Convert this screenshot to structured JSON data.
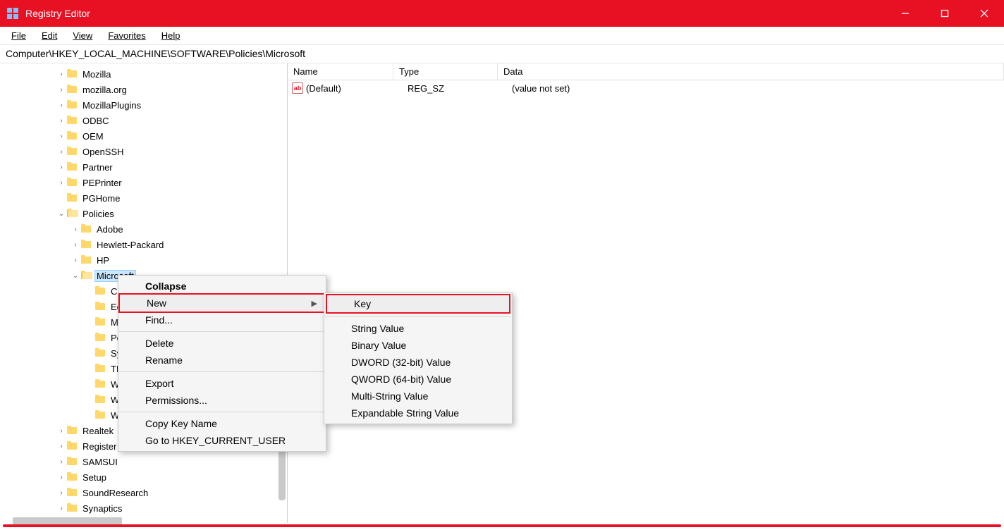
{
  "window": {
    "title": "Registry Editor"
  },
  "menu": {
    "file": "File",
    "edit": "Edit",
    "view": "View",
    "favorites": "Favorites",
    "help": "Help"
  },
  "address": "Computer\\HKEY_LOCAL_MACHINE\\SOFTWARE\\Policies\\Microsoft",
  "tree": {
    "items": [
      {
        "indent": 4,
        "label": "Mozilla"
      },
      {
        "indent": 4,
        "label": "mozilla.org"
      },
      {
        "indent": 4,
        "label": "MozillaPlugins"
      },
      {
        "indent": 4,
        "label": "ODBC"
      },
      {
        "indent": 4,
        "label": "OEM"
      },
      {
        "indent": 4,
        "label": "OpenSSH"
      },
      {
        "indent": 4,
        "label": "Partner"
      },
      {
        "indent": 4,
        "label": "PEPrinter"
      },
      {
        "indent": 4,
        "label": "PGHome",
        "notwisty": true
      },
      {
        "indent": 4,
        "label": "Policies",
        "expanded": true
      },
      {
        "indent": 5,
        "label": "Adobe"
      },
      {
        "indent": 5,
        "label": "Hewlett-Packard"
      },
      {
        "indent": 5,
        "label": "HP"
      },
      {
        "indent": 5,
        "label": "Microsoft",
        "expanded": true,
        "selected": true
      },
      {
        "indent": 6,
        "label": "Cr",
        "notwisty": true
      },
      {
        "indent": 6,
        "label": "Ed",
        "notwisty": true
      },
      {
        "indent": 6,
        "label": "M",
        "notwisty": true
      },
      {
        "indent": 6,
        "label": "Pe",
        "notwisty": true
      },
      {
        "indent": 6,
        "label": "Sy",
        "notwisty": true
      },
      {
        "indent": 6,
        "label": "TP",
        "notwisty": true
      },
      {
        "indent": 6,
        "label": "W",
        "notwisty": true
      },
      {
        "indent": 6,
        "label": "W",
        "notwisty": true
      },
      {
        "indent": 6,
        "label": "W",
        "notwisty": true
      },
      {
        "indent": 4,
        "label": "Realtek"
      },
      {
        "indent": 4,
        "label": "Register"
      },
      {
        "indent": 4,
        "label": "SAMSUI"
      },
      {
        "indent": 4,
        "label": "Setup"
      },
      {
        "indent": 4,
        "label": "SoundResearch"
      },
      {
        "indent": 4,
        "label": "Synaptics"
      }
    ]
  },
  "list": {
    "headers": {
      "name": "Name",
      "type": "Type",
      "data": "Data"
    },
    "rows": [
      {
        "name": "(Default)",
        "type": "REG_SZ",
        "data": "(value not set)",
        "icon": "ab"
      }
    ]
  },
  "ctx1": {
    "collapse": "Collapse",
    "new": "New",
    "find": "Find...",
    "delete": "Delete",
    "rename": "Rename",
    "export": "Export",
    "permissions": "Permissions...",
    "copykey": "Copy Key Name",
    "goto": "Go to HKEY_CURRENT_USER"
  },
  "ctx2": {
    "key": "Key",
    "string": "String Value",
    "binary": "Binary Value",
    "dword": "DWORD (32-bit) Value",
    "qword": "QWORD (64-bit) Value",
    "multi": "Multi-String Value",
    "expand": "Expandable String Value"
  }
}
